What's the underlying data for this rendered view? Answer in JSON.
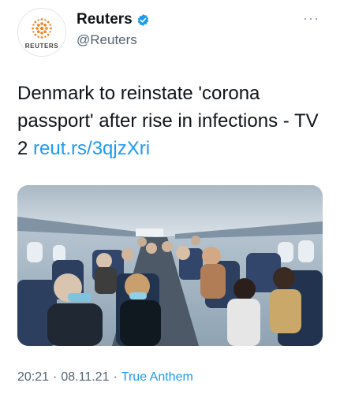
{
  "author": {
    "display_name": "Reuters",
    "handle": "@Reuters",
    "logo_text": "REUTERS",
    "verified": true
  },
  "tweet": {
    "text": "Denmark to reinstate 'corona passport' after rise in infections - TV 2 ",
    "link": "reut.rs/3qjzXri"
  },
  "meta": {
    "time": "20:21",
    "separator": "·",
    "date": "08.11.21",
    "source": "True Anthem"
  },
  "icons": {
    "more": "more-horizontal-icon",
    "verified": "verified-badge-icon"
  },
  "colors": {
    "link": "#1d9bf0",
    "secondary_text": "#536471",
    "logo_orange": "#f58220"
  }
}
